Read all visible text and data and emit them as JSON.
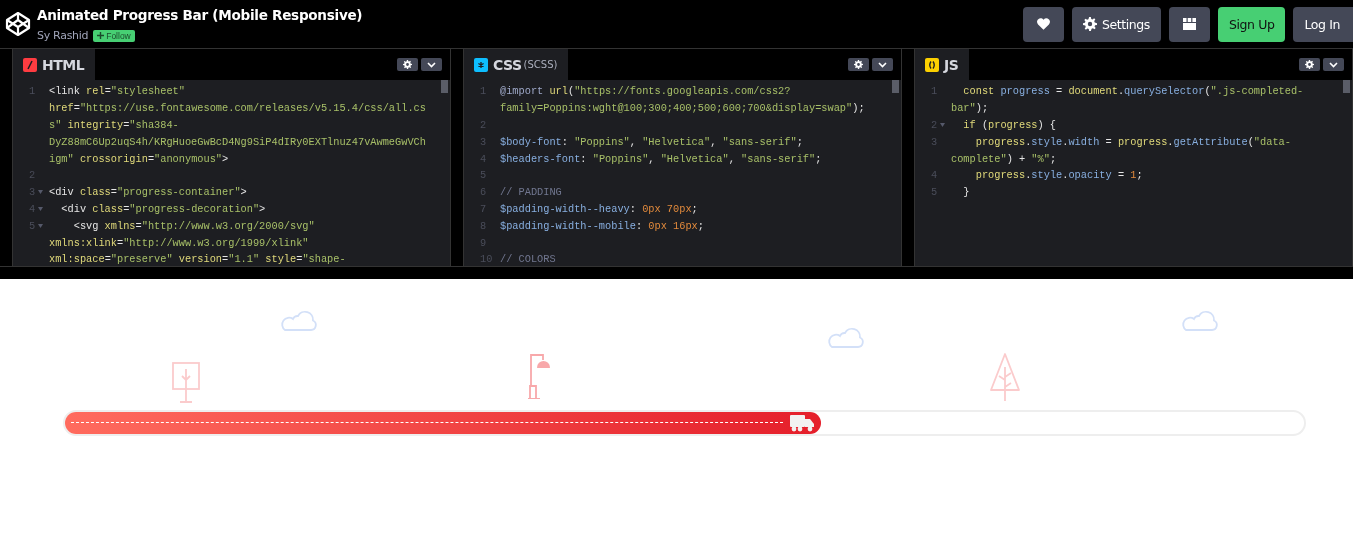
{
  "header": {
    "title": "Animated Progress Bar (Mobile Responsive)",
    "author": "Sy Rashid",
    "follow_label": "Follow",
    "buttons": [
      {
        "kind": "heart"
      },
      {
        "kind": "settings",
        "label": "Settings"
      },
      {
        "kind": "layout"
      },
      {
        "kind": "signup",
        "label": "Sign Up"
      },
      {
        "kind": "login",
        "label": "Log In"
      }
    ]
  },
  "editors": [
    {
      "kind": "html",
      "title": "HTML",
      "rows": [
        {
          "number": "1",
          "fold": false,
          "tokens": [
            {
              "t": "<link",
              "kind": "tag"
            },
            {
              "t": " rel",
              "kind": "attr"
            },
            {
              "t": "=",
              "kind": "punct"
            },
            {
              "t": "\"stylesheet\"",
              "kind": "str"
            }
          ]
        },
        {
          "tokens": [
            {
              "t": "href",
              "kind": "attr"
            },
            {
              "t": "=",
              "kind": "punct"
            },
            {
              "t": "\"https://use.fontawesome.com/releases/v5.15.4/css/all.cs",
              "kind": "str"
            }
          ]
        },
        {
          "tokens": [
            {
              "t": "s\"",
              "kind": "str"
            },
            {
              "t": " integrity",
              "kind": "attr"
            },
            {
              "t": "=",
              "kind": "punct"
            },
            {
              "t": "\"sha384-",
              "kind": "str"
            }
          ]
        },
        {
          "tokens": [
            {
              "t": "DyZ88mC6Up2uqS4h/KRgHuoeGwBcD4Ng9SiP4dIRy0EXTlnuz47vAwmeGwVCh",
              "kind": "str"
            }
          ]
        },
        {
          "tokens": [
            {
              "t": "igm\"",
              "kind": "str"
            },
            {
              "t": " crossorigin",
              "kind": "attr"
            },
            {
              "t": "=",
              "kind": "punct"
            },
            {
              "t": "\"anonymous\"",
              "kind": "str"
            },
            {
              "t": ">",
              "kind": "tag"
            }
          ]
        },
        {
          "number": "2",
          "fold": false,
          "tokens": []
        },
        {
          "number": "3",
          "fold": true,
          "tokens": [
            {
              "t": "<div",
              "kind": "tag"
            },
            {
              "t": " class",
              "kind": "attr"
            },
            {
              "t": "=",
              "kind": "punct"
            },
            {
              "t": "\"progress-container\"",
              "kind": "str"
            },
            {
              "t": ">",
              "kind": "tag"
            }
          ]
        },
        {
          "number": "4",
          "fold": true,
          "tokens": [
            {
              "t": "  <div",
              "kind": "tag"
            },
            {
              "t": " class",
              "kind": "attr"
            },
            {
              "t": "=",
              "kind": "punct"
            },
            {
              "t": "\"progress-decoration\"",
              "kind": "str"
            },
            {
              "t": ">",
              "kind": "tag"
            }
          ]
        },
        {
          "number": "5",
          "fold": true,
          "tokens": [
            {
              "t": "    <svg",
              "kind": "tag"
            },
            {
              "t": " xmlns",
              "kind": "attr"
            },
            {
              "t": "=",
              "kind": "punct"
            },
            {
              "t": "\"http://www.w3.org/2000/svg\"",
              "kind": "str"
            }
          ]
        },
        {
          "tokens": [
            {
              "t": "xmlns:xlink",
              "kind": "attr"
            },
            {
              "t": "=",
              "kind": "punct"
            },
            {
              "t": "\"http://www.w3.org/1999/xlink\"",
              "kind": "str"
            }
          ]
        },
        {
          "tokens": [
            {
              "t": "xml:space",
              "kind": "attr"
            },
            {
              "t": "=",
              "kind": "punct"
            },
            {
              "t": "\"preserve\"",
              "kind": "str"
            },
            {
              "t": " version",
              "kind": "attr"
            },
            {
              "t": "=",
              "kind": "punct"
            },
            {
              "t": "\"1.1\"",
              "kind": "str"
            },
            {
              "t": " style",
              "kind": "attr"
            },
            {
              "t": "=",
              "kind": "punct"
            },
            {
              "t": "\"shape-",
              "kind": "str"
            }
          ]
        }
      ]
    },
    {
      "kind": "css",
      "title": "CSS",
      "subtitle": "(SCSS)",
      "rows": [
        {
          "number": "1",
          "fold": false,
          "tokens": [
            {
              "t": "@import",
              "kind": "kw"
            },
            {
              "t": " url",
              "kind": "fn"
            },
            {
              "t": "(",
              "kind": "punct"
            },
            {
              "t": "\"https://fonts.googleapis.com/css2?",
              "kind": "str"
            }
          ]
        },
        {
          "tokens": [
            {
              "t": "family=Poppins:wght@100;300;400;500;600;700&display=swap\"",
              "kind": "str"
            },
            {
              "t": ");",
              "kind": "punct"
            }
          ]
        },
        {
          "number": "2",
          "fold": false,
          "tokens": []
        },
        {
          "number": "3",
          "fold": false,
          "tokens": [
            {
              "t": "$body-font",
              "kind": "var"
            },
            {
              "t": ": ",
              "kind": "punct"
            },
            {
              "t": "\"Poppins\"",
              "kind": "str"
            },
            {
              "t": ", ",
              "kind": "punct"
            },
            {
              "t": "\"Helvetica\"",
              "kind": "str"
            },
            {
              "t": ", ",
              "kind": "punct"
            },
            {
              "t": "\"sans-serif\"",
              "kind": "str"
            },
            {
              "t": ";",
              "kind": "punct"
            }
          ]
        },
        {
          "number": "4",
          "fold": false,
          "tokens": [
            {
              "t": "$headers-font",
              "kind": "var"
            },
            {
              "t": ": ",
              "kind": "punct"
            },
            {
              "t": "\"Poppins\"",
              "kind": "str"
            },
            {
              "t": ", ",
              "kind": "punct"
            },
            {
              "t": "\"Helvetica\"",
              "kind": "str"
            },
            {
              "t": ", ",
              "kind": "punct"
            },
            {
              "t": "\"sans-serif\"",
              "kind": "str"
            },
            {
              "t": ";",
              "kind": "punct"
            }
          ]
        },
        {
          "number": "5",
          "fold": false,
          "tokens": []
        },
        {
          "number": "6",
          "fold": false,
          "tokens": [
            {
              "t": "// PADDING",
              "kind": "comment"
            }
          ]
        },
        {
          "number": "7",
          "fold": false,
          "tokens": [
            {
              "t": "$padding-width--heavy",
              "kind": "var"
            },
            {
              "t": ": ",
              "kind": "punct"
            },
            {
              "t": "0px 70px",
              "kind": "num"
            },
            {
              "t": ";",
              "kind": "punct"
            }
          ]
        },
        {
          "number": "8",
          "fold": false,
          "tokens": [
            {
              "t": "$padding-width--mobile",
              "kind": "var"
            },
            {
              "t": ": ",
              "kind": "punct"
            },
            {
              "t": "0px 16px",
              "kind": "num"
            },
            {
              "t": ";",
              "kind": "punct"
            }
          ]
        },
        {
          "number": "9",
          "fold": false,
          "tokens": []
        },
        {
          "number": "10",
          "fold": false,
          "tokens": [
            {
              "t": "// COLORS",
              "kind": "comment"
            }
          ]
        }
      ]
    },
    {
      "kind": "js",
      "title": "JS",
      "rows": [
        {
          "number": "1",
          "fold": false,
          "tokens": [
            {
              "t": "  const",
              "kind": "fn"
            },
            {
              "t": " progress",
              "kind": "var"
            },
            {
              "t": " = ",
              "kind": "punct"
            },
            {
              "t": "document",
              "kind": "fn"
            },
            {
              "t": ".",
              "kind": "punct"
            },
            {
              "t": "querySelector",
              "kind": "var"
            },
            {
              "t": "(",
              "kind": "punct"
            },
            {
              "t": "\".js-completed-",
              "kind": "str"
            }
          ]
        },
        {
          "tokens": [
            {
              "t": "bar\"",
              "kind": "str"
            },
            {
              "t": ");",
              "kind": "punct"
            }
          ]
        },
        {
          "number": "2",
          "fold": true,
          "tokens": [
            {
              "t": "  if",
              "kind": "fn"
            },
            {
              "t": " (",
              "kind": "punct"
            },
            {
              "t": "progress",
              "kind": "fn"
            },
            {
              "t": ") {",
              "kind": "punct"
            }
          ]
        },
        {
          "number": "3",
          "fold": false,
          "tokens": [
            {
              "t": "    progress",
              "kind": "fn"
            },
            {
              "t": ".",
              "kind": "punct"
            },
            {
              "t": "style",
              "kind": "var"
            },
            {
              "t": ".",
              "kind": "punct"
            },
            {
              "t": "width",
              "kind": "var"
            },
            {
              "t": " = ",
              "kind": "punct"
            },
            {
              "t": "progress",
              "kind": "fn"
            },
            {
              "t": ".",
              "kind": "punct"
            },
            {
              "t": "getAttribute",
              "kind": "var"
            },
            {
              "t": "(",
              "kind": "punct"
            },
            {
              "t": "\"data-",
              "kind": "str"
            }
          ]
        },
        {
          "tokens": [
            {
              "t": "complete\"",
              "kind": "str"
            },
            {
              "t": ") + ",
              "kind": "punct"
            },
            {
              "t": "\"%\"",
              "kind": "str"
            },
            {
              "t": ";",
              "kind": "punct"
            }
          ]
        },
        {
          "number": "4",
          "fold": false,
          "tokens": [
            {
              "t": "    progress",
              "kind": "fn"
            },
            {
              "t": ".",
              "kind": "punct"
            },
            {
              "t": "style",
              "kind": "var"
            },
            {
              "t": ".",
              "kind": "punct"
            },
            {
              "t": "opacity",
              "kind": "var"
            },
            {
              "t": " = ",
              "kind": "punct"
            },
            {
              "t": "1",
              "kind": "num"
            },
            {
              "t": ";",
              "kind": "punct"
            }
          ]
        },
        {
          "number": "5",
          "fold": false,
          "tokens": [
            {
              "t": "  }",
              "kind": "punct"
            }
          ]
        }
      ]
    }
  ],
  "preview": {
    "progress": {
      "level": 0.61
    }
  }
}
